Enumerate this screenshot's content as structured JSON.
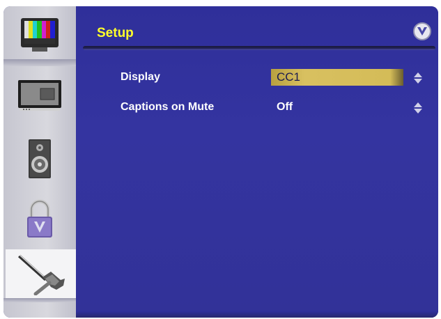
{
  "menu": {
    "title": "Setup"
  },
  "sidebar": {
    "items": [
      {
        "icon": "tv-color-bars-icon",
        "active": false
      },
      {
        "icon": "monitor-pip-icon",
        "active": false
      },
      {
        "icon": "speaker-icon",
        "active": false
      },
      {
        "icon": "padlock-icon",
        "active": false
      },
      {
        "icon": "wrench-icon",
        "active": true
      }
    ]
  },
  "settings": [
    {
      "label": "Display",
      "value": "CC1",
      "selected": true
    },
    {
      "label": "Captions on Mute",
      "value": "Off",
      "selected": false
    }
  ],
  "colors": {
    "title": "#ffff2a",
    "panel": "#3434a0",
    "highlight": "#d4bc58"
  }
}
